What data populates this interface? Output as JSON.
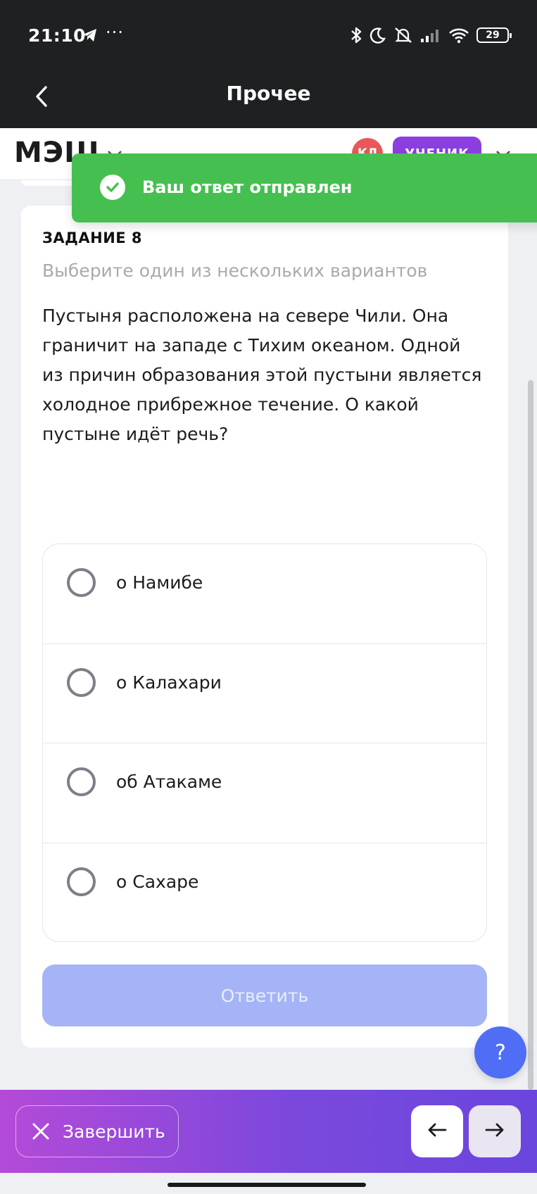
{
  "status_bar": {
    "time": "21:10",
    "dots": "···",
    "battery": "29",
    "icons": [
      "telegram-icon",
      "bluetooth-icon",
      "moon-icon",
      "bell-muted-icon",
      "signal-icon",
      "wifi-icon",
      "battery-icon"
    ]
  },
  "title_bar": {
    "title": "Прочее",
    "back_icon": "chevron-left-icon"
  },
  "app_header": {
    "logo": "МЭШ",
    "avatar_initials": "КЛ",
    "role_badge": "УЧЕНИК"
  },
  "toast": {
    "message": "Ваш ответ отправлен",
    "icon": "check-circle-icon",
    "color": "#45c050"
  },
  "task": {
    "label": "ЗАДАНИЕ 8",
    "instruction": "Выберите один из нескольких вариантов",
    "question": "Пустыня расположена на севере Чили. Она граничит на западе с Тихим океаном. Одной из причин образования этой пустыни является холодное прибрежное течение. О какой пустыне идёт речь?",
    "options": [
      {
        "label": "о Намибе"
      },
      {
        "label": "о Калахари"
      },
      {
        "label": "об Атакаме"
      },
      {
        "label": "о Сахаре"
      }
    ],
    "submit_label": "Ответить"
  },
  "help": {
    "label": "?"
  },
  "bottom_bar": {
    "finish_label": "Завершить"
  },
  "colors": {
    "accent": "#4f6ef5",
    "submit_disabled": "#a5b4f6",
    "role_badge": "#8b3fe0",
    "avatar": "#e8585a"
  }
}
